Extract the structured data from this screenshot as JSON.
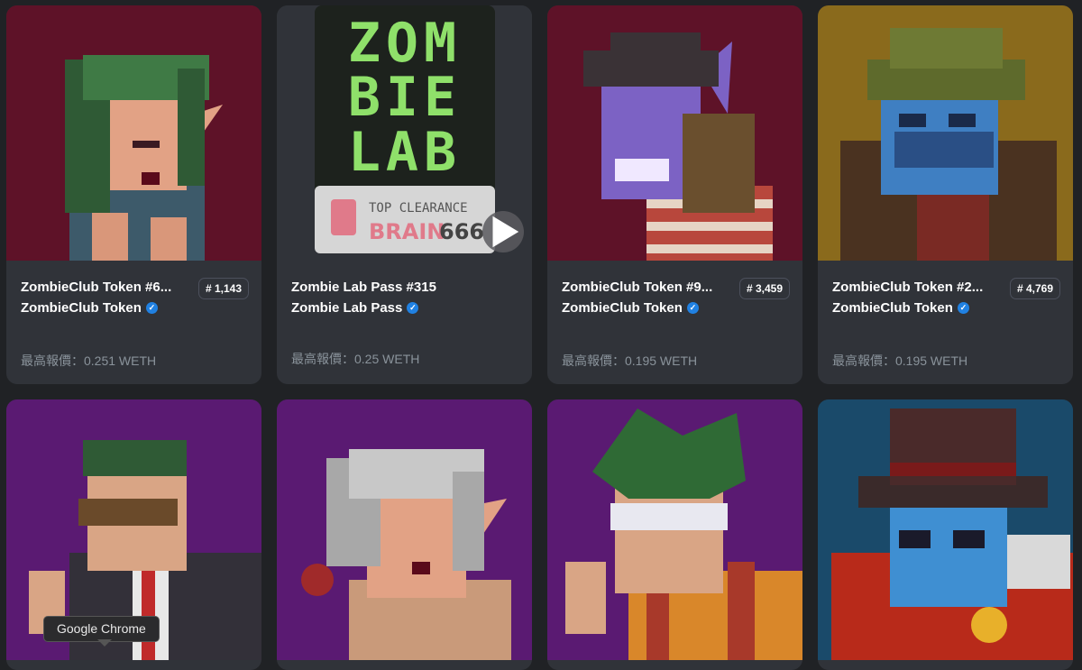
{
  "cards": [
    {
      "title": "ZombieClub Token #6...",
      "rank": "# 1,143",
      "collection": "ZombieClub Token",
      "offer": "最高報價：0.251 WETH",
      "art": "elf-girl-green-hair"
    },
    {
      "title": "Zombie Lab Pass #315",
      "rank": "",
      "collection": "Zombie Lab Pass",
      "offer": "最高報價：0.25 WETH",
      "art": "zombie-lab-pass",
      "pass": {
        "line1": "ZOM",
        "line2": "BIE",
        "line3": "LAB",
        "clearance": "TOP CLEARANCE",
        "brain": "BRAIN",
        "code": "666"
      }
    },
    {
      "title": "ZombieClub Token #9...",
      "rank": "# 3,459",
      "collection": "ZombieClub Token",
      "offer": "最高報價：0.195 WETH",
      "art": "purple-zombie-hat"
    },
    {
      "title": "ZombieClub Token #2...",
      "rank": "# 4,769",
      "collection": "ZombieClub Token",
      "offer": "最高報價：0.195 WETH",
      "art": "blue-zombie-helmet"
    },
    {
      "art": "man-suit-sunglasses"
    },
    {
      "art": "elf-girl-silver-hair"
    },
    {
      "art": "man-green-spiky-hair"
    },
    {
      "art": "blue-zombie-top-hat"
    }
  ],
  "colors": {
    "background": "#202225",
    "card": "#303339",
    "muted": "#8a939b",
    "verified": "#2081e2"
  },
  "tooltip": {
    "label": "Google Chrome"
  }
}
